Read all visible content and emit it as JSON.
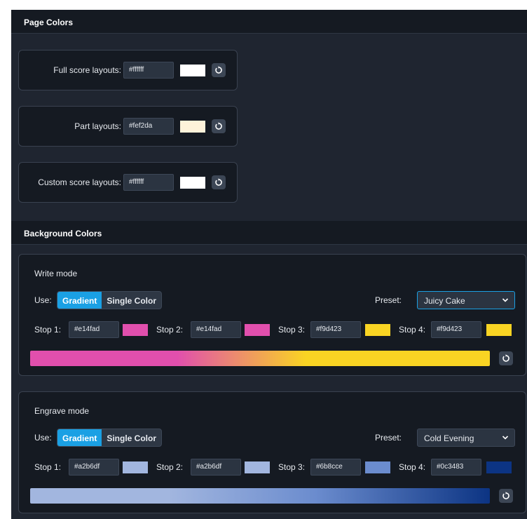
{
  "page_colors": {
    "title": "Page Colors",
    "rows": [
      {
        "label": "Full score layouts:",
        "hex": "#ffffff",
        "color": "#ffffff"
      },
      {
        "label": "Part layouts:",
        "hex": "#fef2da",
        "color": "#fef2da"
      },
      {
        "label": "Custom score layouts:",
        "hex": "#ffffff",
        "color": "#ffffff"
      }
    ]
  },
  "background_colors": {
    "title": "Background Colors",
    "modes": [
      {
        "title": "Write mode",
        "use_label": "Use:",
        "gradient_label": "Gradient",
        "single_label": "Single Color",
        "preset_label": "Preset:",
        "preset_value": "Juicy Cake",
        "stops": [
          {
            "label": "Stop 1:",
            "hex": "#e14fad",
            "color": "#e14fad"
          },
          {
            "label": "Stop 2:",
            "hex": "#e14fad",
            "color": "#e14fad"
          },
          {
            "label": "Stop 3:",
            "hex": "#f9d423",
            "color": "#f9d423"
          },
          {
            "label": "Stop 4:",
            "hex": "#f9d423",
            "color": "#f9d423"
          }
        ]
      },
      {
        "title": "Engrave mode",
        "use_label": "Use:",
        "gradient_label": "Gradient",
        "single_label": "Single Color",
        "preset_label": "Preset:",
        "preset_value": "Cold Evening",
        "stops": [
          {
            "label": "Stop 1:",
            "hex": "#a2b6df",
            "color": "#a2b6df"
          },
          {
            "label": "Stop 2:",
            "hex": "#a2b6df",
            "color": "#a2b6df"
          },
          {
            "label": "Stop 3:",
            "hex": "#6b8cce",
            "color": "#6b8cce"
          },
          {
            "label": "Stop 4:",
            "hex": "#0c3483",
            "color": "#0c3483"
          }
        ]
      }
    ]
  },
  "icons": {
    "reset": "reset-icon",
    "chevron": "chevron-down-icon"
  }
}
